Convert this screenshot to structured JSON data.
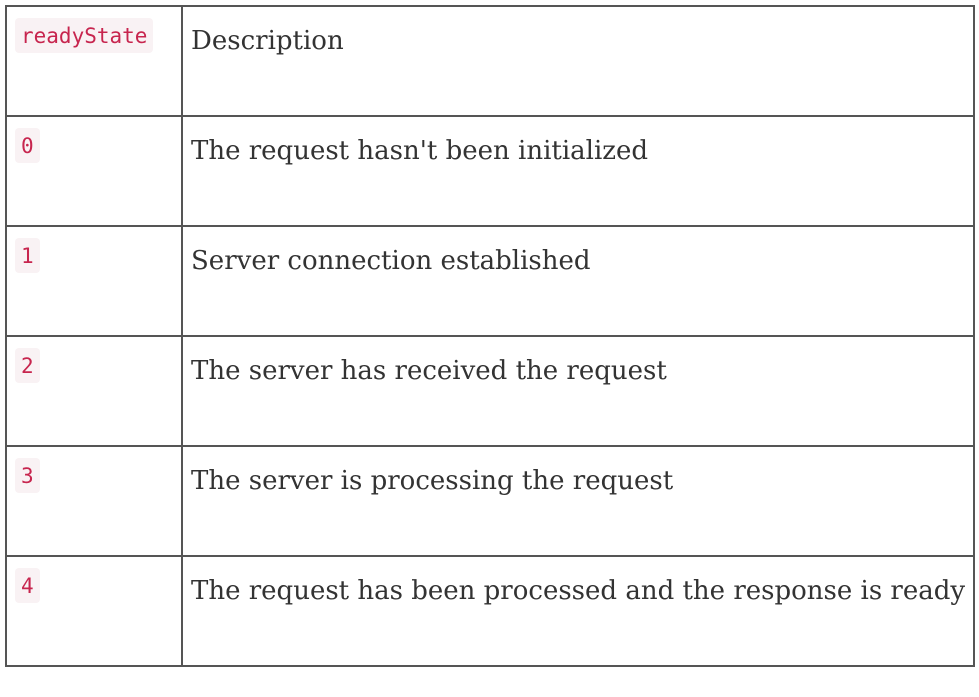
{
  "table": {
    "header": {
      "state": "readyState",
      "description": "Description"
    },
    "rows": [
      {
        "state": "0",
        "description": "The request hasn't been initialized"
      },
      {
        "state": "1",
        "description": "Server connection established"
      },
      {
        "state": "2",
        "description": "The server has received the request"
      },
      {
        "state": "3",
        "description": "The server is processing the request"
      },
      {
        "state": "4",
        "description": "The request has been processed and the response is ready"
      }
    ]
  }
}
